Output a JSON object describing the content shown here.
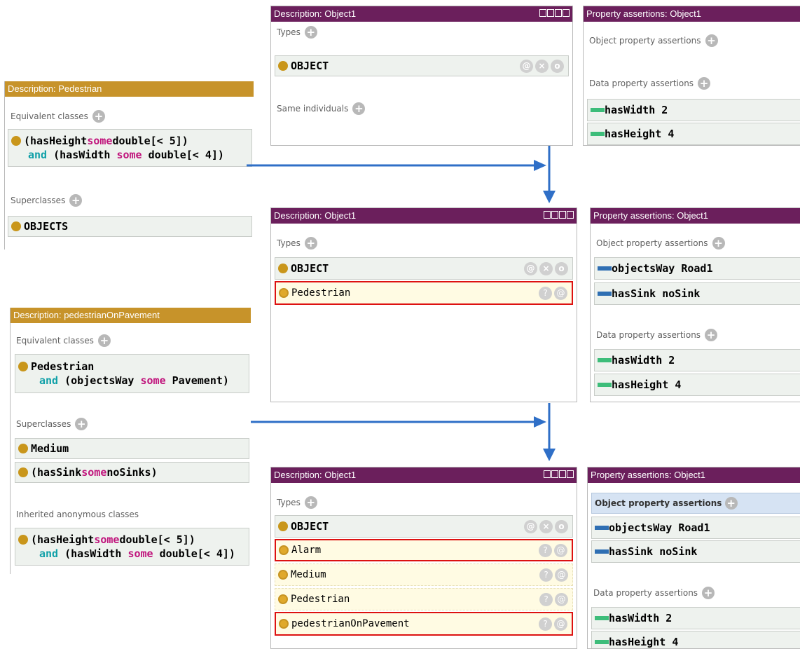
{
  "top_desc": {
    "title": "Description: Object1",
    "types_label": "Types",
    "type_object": "OBJECT",
    "same_label": "Same individuals"
  },
  "top_props": {
    "title": "Property assertions: Object1",
    "obj_label": "Object property assertions",
    "data_label": "Data property assertions",
    "data": [
      {
        "prop": "hasWidth",
        "val": "2"
      },
      {
        "prop": "hasHeight",
        "val": "4"
      }
    ]
  },
  "pedestrian_desc": {
    "title": "Description: Pedestrian",
    "equiv_label": "Equivalent classes",
    "expr": {
      "l1_open": "(hasHeight ",
      "l1_kw": "some",
      "l1_rest": " double[< 5])",
      "l2_and": "and",
      "l2_open": " (hasWidth ",
      "l2_kw": "some",
      "l2_rest": " double[< 4])"
    },
    "super_label": "Superclasses",
    "super": "OBJECTS"
  },
  "mid_desc": {
    "title": "Description: Object1",
    "types_label": "Types",
    "type_object": "OBJECT",
    "inferred": "Pedestrian"
  },
  "mid_props": {
    "title": "Property assertions: Object1",
    "obj_label": "Object property assertions",
    "obj": [
      {
        "prop": "objectsWay",
        "val": "Road1"
      },
      {
        "prop": "hasSink",
        "val": "noSink"
      }
    ],
    "data_label": "Data property assertions",
    "data": [
      {
        "prop": "hasWidth",
        "val": "2"
      },
      {
        "prop": "hasHeight",
        "val": "4"
      }
    ]
  },
  "pop_desc": {
    "title": "Description: pedestrianOnPavement",
    "equiv_label": "Equivalent classes",
    "expr": {
      "l1": "Pedestrian",
      "l2_and": "and",
      "l2_open": " (objectsWay ",
      "l2_kw": "some",
      "l2_rest": " Pavement)"
    },
    "super_label": "Superclasses",
    "super1": "Medium",
    "super2": {
      "open": "(hasSink ",
      "kw": "some",
      "rest": " noSinks)"
    },
    "inherited_label": "Inherited anonymous classes",
    "inherited": {
      "l1_open": "(hasHeight ",
      "l1_kw": "some",
      "l1_rest": " double[< 5])",
      "l2_and": "and",
      "l2_open": " (hasWidth ",
      "l2_kw": "some",
      "l2_rest": " double[< 4])"
    }
  },
  "bot_desc": {
    "title": "Description: Object1",
    "types_label": "Types",
    "type_object": "OBJECT",
    "inferred": [
      "Alarm",
      "Medium",
      "Pedestrian",
      "pedestrianOnPavement"
    ]
  },
  "bot_props": {
    "title": "Property assertions: Object1",
    "obj_label": "Object property assertions",
    "obj": [
      {
        "prop": "objectsWay",
        "val": "Road1"
      },
      {
        "prop": "hasSink",
        "val": "noSink"
      }
    ],
    "data_label": "Data property assertions",
    "data": [
      {
        "prop": "hasWidth",
        "val": "2"
      },
      {
        "prop": "hasHeight",
        "val": "4"
      }
    ]
  },
  "colors": {
    "title_purple": "#6b1f5c",
    "title_gold": "#c7932a",
    "arrow_blue": "#2f6fc7",
    "highlight_red": "#dd1111"
  }
}
